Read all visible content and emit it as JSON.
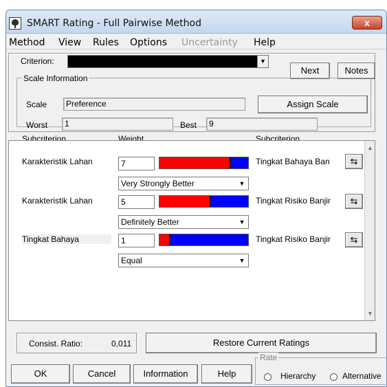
{
  "window": {
    "title": "SMART Rating - Full Pairwise Method",
    "close_label": "x"
  },
  "menu": [
    "Method",
    "View",
    "Rules",
    "Options",
    "Uncertainty",
    "Help"
  ],
  "criterion": {
    "label": "Criterion:",
    "value": "",
    "next_label": "Next",
    "notes_label": "Notes"
  },
  "scale_info": {
    "group_title": "Scale Information",
    "scale_label": "Scale",
    "scale_value": "Preference",
    "assign_label": "Assign Scale",
    "worst_label": "Worst",
    "worst_value": "1",
    "best_label": "Best",
    "best_value": "9"
  },
  "grid": {
    "col_left": "Subcriterion",
    "col_weight": "Weight",
    "col_right": "Subcriterion",
    "rows": [
      {
        "left": "Karakteristik Lahan",
        "weight": "7",
        "bar_fraction": 0.8,
        "verbal": "Very Strongly Better",
        "right": "Tingkat Bahaya Ban"
      },
      {
        "left": "Karakteristik Lahan",
        "weight": "5",
        "bar_fraction": 0.57,
        "verbal": "Definitely Better",
        "right": "Tingkat Risiko Banjir"
      },
      {
        "left": "Tingkat Bahaya",
        "weight": "1",
        "bar_fraction": 0.12,
        "verbal": "Equal",
        "right": "Tingkat Risiko Banjir"
      }
    ],
    "swap_icon": "swap-arrows-icon"
  },
  "consistency": {
    "label": "Consist. Ratio:",
    "value": "0,011",
    "restore_label": "Restore Current Ratings"
  },
  "footer": {
    "ok_label": "OK",
    "cancel_label": "Cancel",
    "information_label": "Information",
    "help_label": "Help",
    "rate_title": "Rate",
    "rate_hierarchy": "Hierarchy",
    "rate_alternative": "Alternative"
  },
  "colors": {
    "bar_left": "#ff0000",
    "bar_right": "#0000ff"
  }
}
